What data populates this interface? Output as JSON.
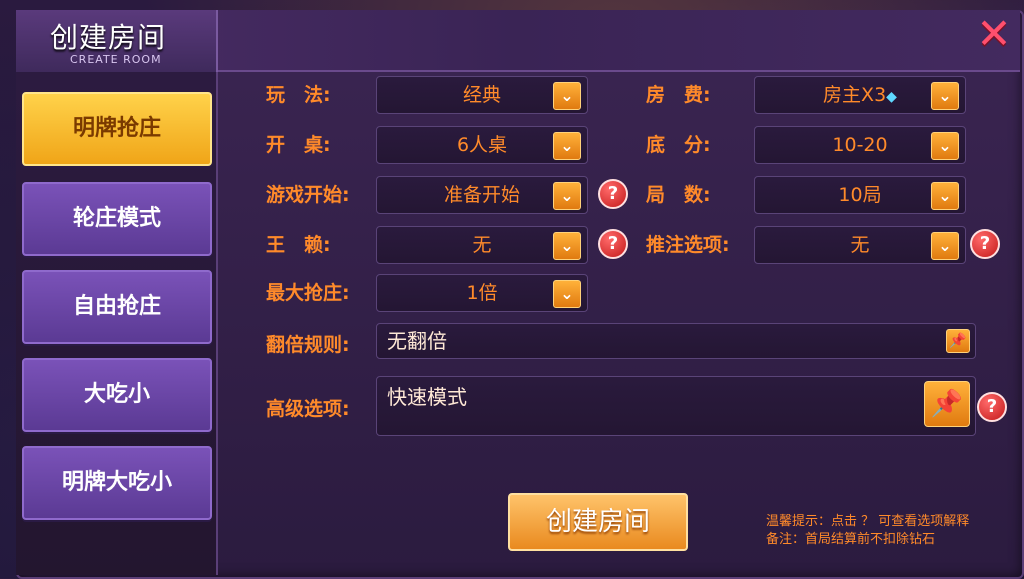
{
  "window": {
    "title": "创建房间",
    "subtitle": "CREATE ROOM",
    "close_icon": "close-icon"
  },
  "sidebar": {
    "items": [
      {
        "label": "明牌抢庄",
        "active": true
      },
      {
        "label": "轮庄模式",
        "active": false
      },
      {
        "label": "自由抢庄",
        "active": false
      },
      {
        "label": "大吃小",
        "active": false
      },
      {
        "label": "明牌大吃小",
        "active": false
      }
    ]
  },
  "form": {
    "play_label": "玩　法:",
    "play_value": "经典",
    "fee_label": "房　费:",
    "fee_value": "房主X3",
    "fee_icon": "diamond-icon",
    "table_label": "开　桌:",
    "table_value": "6人桌",
    "base_label": "底　分:",
    "base_value": "10-20",
    "start_label": "游戏开始:",
    "start_value": "准备开始",
    "rounds_label": "局　数:",
    "rounds_value": "10局",
    "wild_label": "王　赖:",
    "wild_value": "无",
    "push_label": "推注选项:",
    "push_value": "无",
    "maxbank_label": "最大抢庄:",
    "maxbank_value": "1倍",
    "double_label": "翻倍规则:",
    "double_value": "无翻倍",
    "advanced_label": "高级选项:",
    "advanced_value": "快速模式"
  },
  "actions": {
    "create_label": "创建房间"
  },
  "tips": {
    "line1": "温馨提示：点击 ？ 可查看选项解释",
    "line2": "备注：首局结算前不扣除钻石"
  },
  "colors": {
    "accent": "#ff8a2a",
    "active_tab": "#ffd24a",
    "tab": "#6a46a6",
    "close": "#ff4f6d"
  }
}
